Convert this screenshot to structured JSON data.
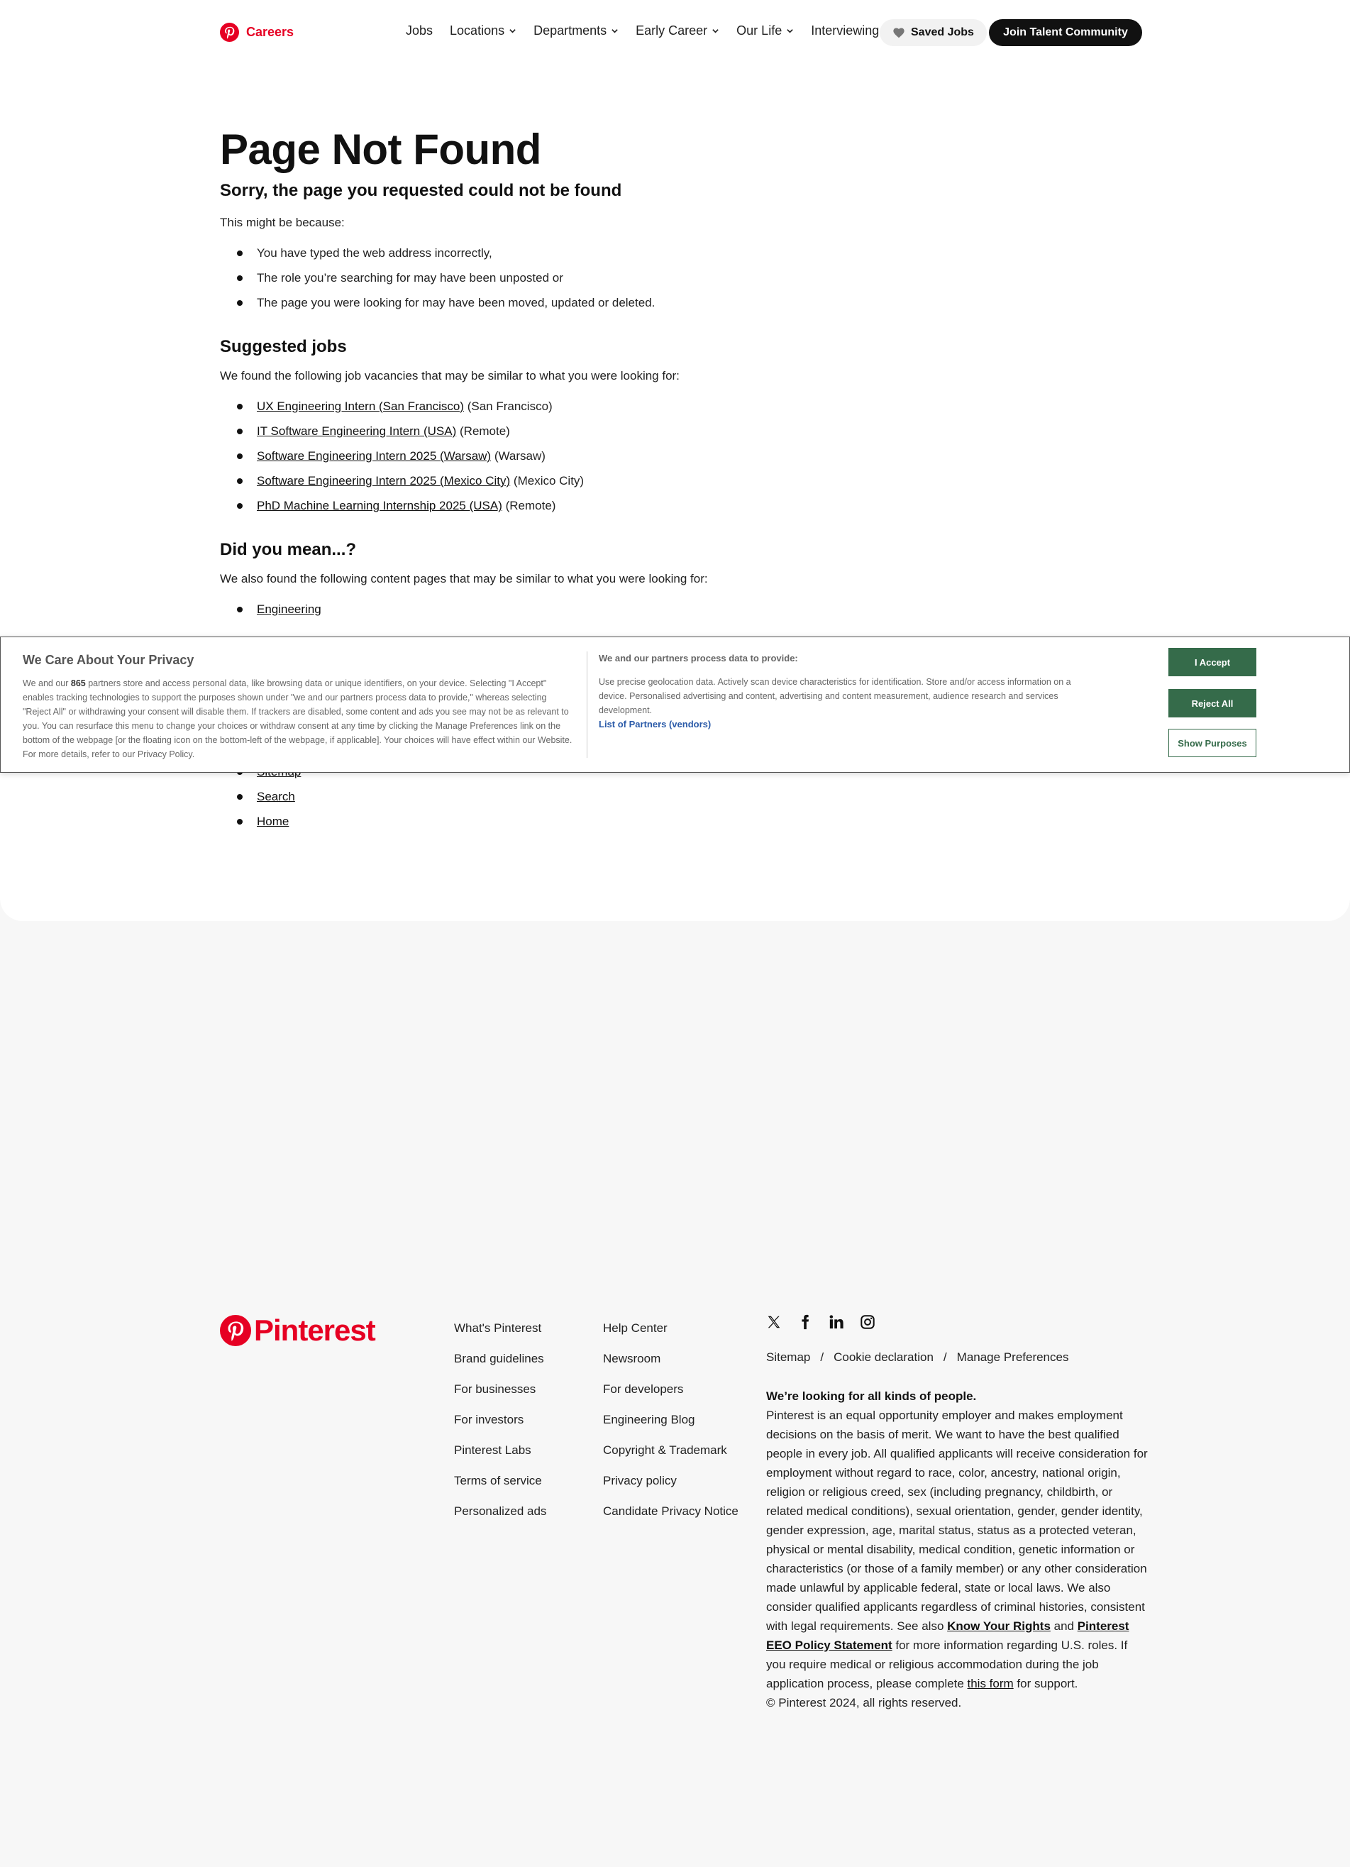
{
  "header": {
    "brand": "Careers",
    "nav": [
      {
        "label": "Jobs",
        "has_dropdown": false
      },
      {
        "label": "Locations",
        "has_dropdown": true
      },
      {
        "label": "Departments",
        "has_dropdown": true
      },
      {
        "label": "Early Career",
        "has_dropdown": true
      },
      {
        "label": "Our Life",
        "has_dropdown": true
      },
      {
        "label": "Interviewing",
        "has_dropdown": false
      }
    ],
    "saved_jobs": "Saved Jobs",
    "join": "Join Talent Community"
  },
  "main": {
    "title": "Page Not Found",
    "subtitle": "Sorry, the page you requested could not be found",
    "reason_intro": "This might be because:",
    "reasons": [
      "You have typed the web address incorrectly,",
      "The role you’re searching for may have been unposted or",
      "The page you were looking for may have been moved, updated or deleted."
    ],
    "suggested_heading": "Suggested jobs",
    "suggested_intro": "We found the following job vacancies that may be similar to what you were looking for:",
    "jobs": [
      {
        "title": "UX Engineering Intern (San Francisco)",
        "location": "(San Francisco)"
      },
      {
        "title": "IT Software Engineering Intern (USA)",
        "location": "(Remote)"
      },
      {
        "title": "Software Engineering Intern 2025 (Warsaw)",
        "location": "(Warsaw)"
      },
      {
        "title": "Software Engineering Intern 2025 (Mexico City)",
        "location": "(Mexico City)"
      },
      {
        "title": "PhD Machine Learning Internship 2025 (USA)",
        "location": "(Remote)"
      }
    ],
    "did_you_mean_heading": "Did you mean...?",
    "did_you_mean_intro": "We also found the following content pages that may be similar to what you were looking for:",
    "pages_before_banner": [
      "Engineering"
    ],
    "pages_after_banner": [
      "Sitemap",
      "Search",
      "Home"
    ]
  },
  "cookie_banner": {
    "title": "We Care About Your Privacy",
    "text_before_count": "We and our ",
    "partner_count": "865",
    "text_after_count": " partners store and access personal data, like browsing data or unique identifiers, on your device. Selecting \"I Accept\" enables tracking technologies to support the purposes shown under \"we and our partners process data to provide,\" whereas selecting \"Reject All\" or withdrawing your consent will disable them. If trackers are disabled, some content and ads you see may not be as relevant to you. You can resurface this menu to change your choices or withdraw consent at any time by clicking the Manage Preferences link on the bottom of the webpage [or the floating icon on the bottom-left of the webpage, if applicable]. Your choices will have effect within our Website. For more details, refer to our Privacy Policy.",
    "purposes_heading": "We and our partners process data to provide:",
    "purposes_text": "Use precise geolocation data. Actively scan device characteristics for identification. Store and/or access information on a device. Personalised advertising and content, advertising and content measurement, audience research and services development.",
    "partners_link": "List of Partners (vendors)",
    "accept": "I Accept",
    "reject": "Reject All",
    "show_purposes": "Show Purposes",
    "accent_color": "#356b4a"
  },
  "footer": {
    "logo_text": "Pinterest",
    "col1": [
      "What's Pinterest",
      "Brand guidelines",
      "For businesses",
      "For investors",
      "Pinterest Labs",
      "Terms of service",
      "Personalized ads"
    ],
    "col2": [
      "Help Center",
      "Newsroom",
      "For developers",
      "Engineering Blog",
      "Copyright & Trademark",
      "Privacy policy",
      "Candidate Privacy Notice"
    ],
    "social_icons": [
      "x-icon",
      "facebook-icon",
      "linkedin-icon",
      "instagram-icon"
    ],
    "links": [
      "Sitemap",
      "Cookie declaration",
      "Manage Preferences"
    ],
    "separator": "/",
    "eeo_title": "We’re looking for all kinds of people.",
    "eeo_text_1": "Pinterest is an equal opportunity employer and makes employment decisions on the basis of merit. We want to have the best qualified people in every job. All qualified applicants will receive consideration for employment without regard to race, color, ancestry, national origin, religion or religious creed, sex (including pregnancy, childbirth, or related medical conditions), sexual orientation, gender, gender identity, gender expression, age, marital status, status as a protected veteran, physical or mental disability, medical condition, genetic information or characteristics (or those of a family member) or any other consideration made unlawful by applicable federal, state or local laws. We also consider qualified applicants regardless of criminal histories, consistent with legal requirements. See also ",
    "eeo_link_1": "Know Your Rights",
    "eeo_and": " and ",
    "eeo_link_2": "Pinterest EEO Policy Statement",
    "eeo_text_2": " for more information regarding U.S. roles. If you require medical or religious accommodation during the job application process, please complete ",
    "eeo_link_3": "this form",
    "eeo_text_3": " for support.",
    "copyright": "© Pinterest 2024, all rights reserved."
  },
  "colors": {
    "brand_red": "#e60023",
    "footer_bg": "#f7f7f7"
  }
}
